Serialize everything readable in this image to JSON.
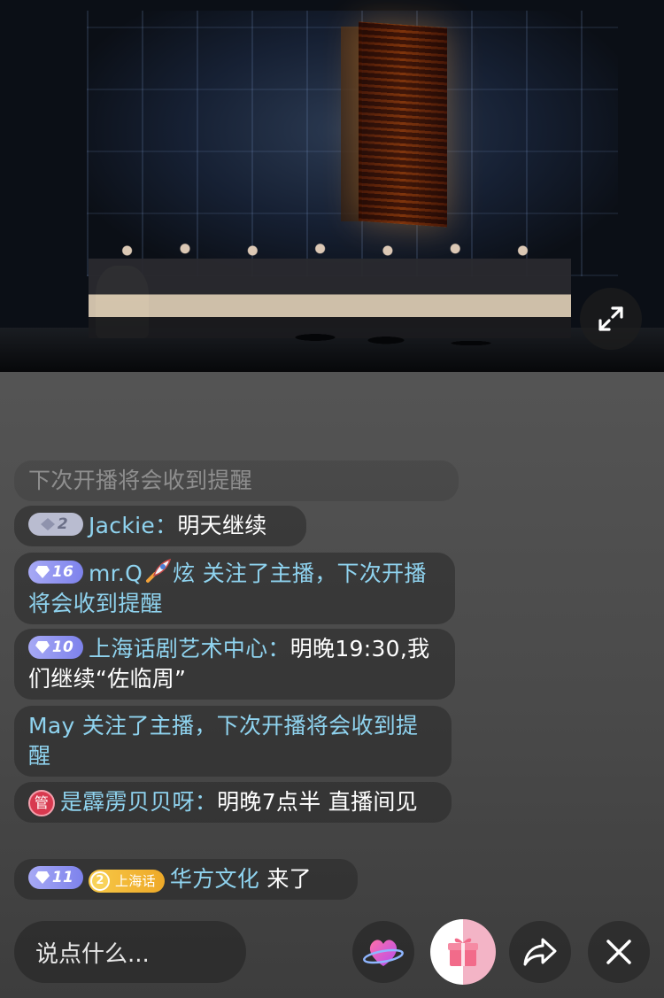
{
  "video": {
    "expand_icon": "expand-arrows-icon"
  },
  "chat": {
    "messages": [
      {
        "text": "下次开播将会收到提醒"
      },
      {
        "level": "2",
        "name": "Jackie",
        "sep": "：",
        "text": "明天继续"
      },
      {
        "level": "16",
        "name": "mr.Q",
        "name_suffix": "炫",
        "text": " 关注了主播，下次开播将会收到提醒"
      },
      {
        "level": "10",
        "name": "上海话剧艺术中心",
        "sep": "：",
        "text": "明晚19:30,我们继续“佐临周”"
      },
      {
        "name": "May",
        "text": " 关注了主播，下次开播将会收到提醒"
      },
      {
        "badge": "管",
        "name": "是霹雳贝贝呀",
        "sep": "：",
        "text": "明晚7点半 直播间见"
      },
      {
        "level": "11",
        "fan_level": "2",
        "fan_group": "上海话",
        "name": "华方文化",
        "text": " 来了"
      }
    ]
  },
  "bottom_bar": {
    "input_placeholder": "说点什么...",
    "icons": [
      "heart-planet-icon",
      "gift-icon",
      "share-icon",
      "close-icon"
    ]
  },
  "colors": {
    "name": "#8fd3ef",
    "admin": "#d8394f",
    "fan_badge": "#eea928"
  }
}
